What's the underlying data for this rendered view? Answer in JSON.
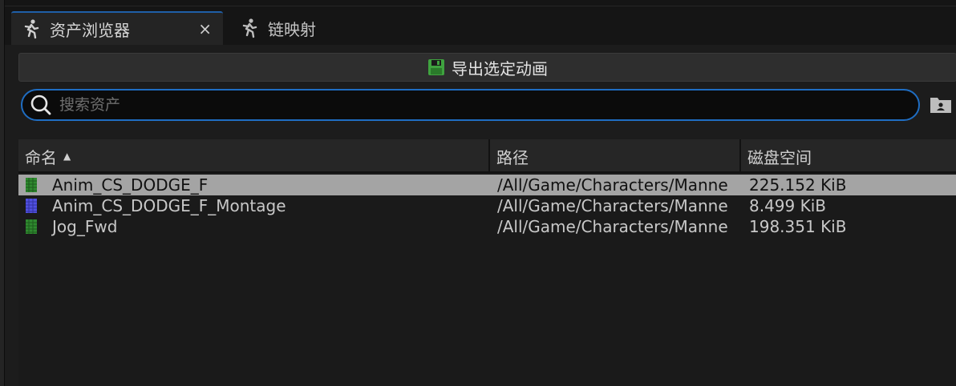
{
  "tabs": [
    {
      "label": "资产浏览器",
      "icon": "running-figure-icon",
      "active": true,
      "close": "×"
    },
    {
      "label": "链映射",
      "icon": "running-figure-icon",
      "active": false
    }
  ],
  "toolbar": {
    "export_label": "导出选定动画",
    "export_icon": "save-icon"
  },
  "search": {
    "placeholder": "搜索资产",
    "value": ""
  },
  "table": {
    "columns": [
      {
        "label": "命名",
        "sort": "ascending"
      },
      {
        "label": "路径"
      },
      {
        "label": "磁盘空间"
      }
    ],
    "rows": [
      {
        "name": "Anim_CS_DODGE_F",
        "path": "/All/Game/Characters/Manne",
        "size": "225.152 KiB",
        "icon": "animation-sequence-icon",
        "icon_color": "#2f8a2f",
        "selected": true
      },
      {
        "name": "Anim_CS_DODGE_F_Montage",
        "path": "/All/Game/Characters/Manne",
        "size": "8.499 KiB",
        "icon": "animation-montage-icon",
        "icon_color": "#5050e0",
        "selected": false
      },
      {
        "name": "Jog_Fwd",
        "path": "/All/Game/Characters/Manne",
        "size": "198.351 KiB",
        "icon": "animation-sequence-icon",
        "icon_color": "#2f8a2f",
        "selected": false
      }
    ]
  },
  "colors": {
    "accent": "#1f6dc2",
    "background": "#1c1c1c",
    "selected_row": "#a4a4a4"
  }
}
